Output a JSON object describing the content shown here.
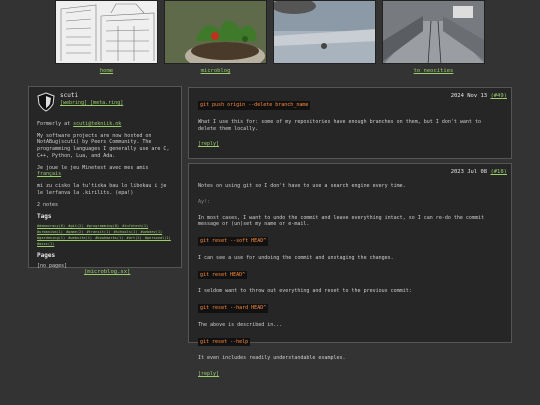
{
  "nav": {
    "home": "home",
    "microblog": "microblog",
    "to_neocities": "to neocities"
  },
  "profile": {
    "name": "scuti",
    "links": "[webring] [meta.ring]",
    "formerly_prefix": "Formerly at",
    "formerly_link": "scuti@tekniik.nk",
    "projects": "My software projects are now hosted on NotABug(scuti) by Peers Community. The programming languages I generally use are C, C++, Python, Lua, and Ada.",
    "minetest_prefix": "Je joue le jeu Minetest avec mes amis",
    "minetest_link": "français",
    "tokipona": "mi zu cisko la tu'tiska bau lo libokau i je le lerfanva la .kirilits. (epa!)",
    "notes_count": "2 notes",
    "tags_heading": "Tags",
    "tags": "#democracy(6) #git(2) #programming(8) #infotech(1) #urbanism(1) #game(2) #transit(1) #schools(1) #webdev(1) #gardening(1) #website(1) #bookmarks(1) #art(2) #personal(1) #misc(1)",
    "pages_heading": "Pages",
    "pages": "[no pages]",
    "microblog_link": "[microblog.sx]"
  },
  "note1": {
    "date": "2024 Nov 13",
    "id": "(#49)",
    "command": "git push origin --delete branch_name",
    "body": "What I use this for: some of my repositories have enough branches on them, but I don't want to delete them locally.",
    "reply": "[reply]"
  },
  "note2": {
    "date": "2023 Jul 08",
    "id": "(#18)",
    "intro": "Notes on using git so I don't have to use a search engine every time.",
    "meta": "Ay!:",
    "para1": "In most cases, I want to undo the commit and leave everything intact, so I can re-do the commit message or (un)set my name or e-mail.",
    "cmd1": "git reset --soft HEAD^",
    "para2": "I can see a use for undoing the commit and unstaging the changes.",
    "cmd2": "git reset HEAD^",
    "para3": "I seldom want to throw out everything and reset to the previous commit:",
    "cmd3": "git reset --hard HEAD^",
    "para4": "The above is described in...",
    "cmd4": "git reset --help",
    "para5": "It even includes readily understandable examples.",
    "reply": "[reply]"
  }
}
